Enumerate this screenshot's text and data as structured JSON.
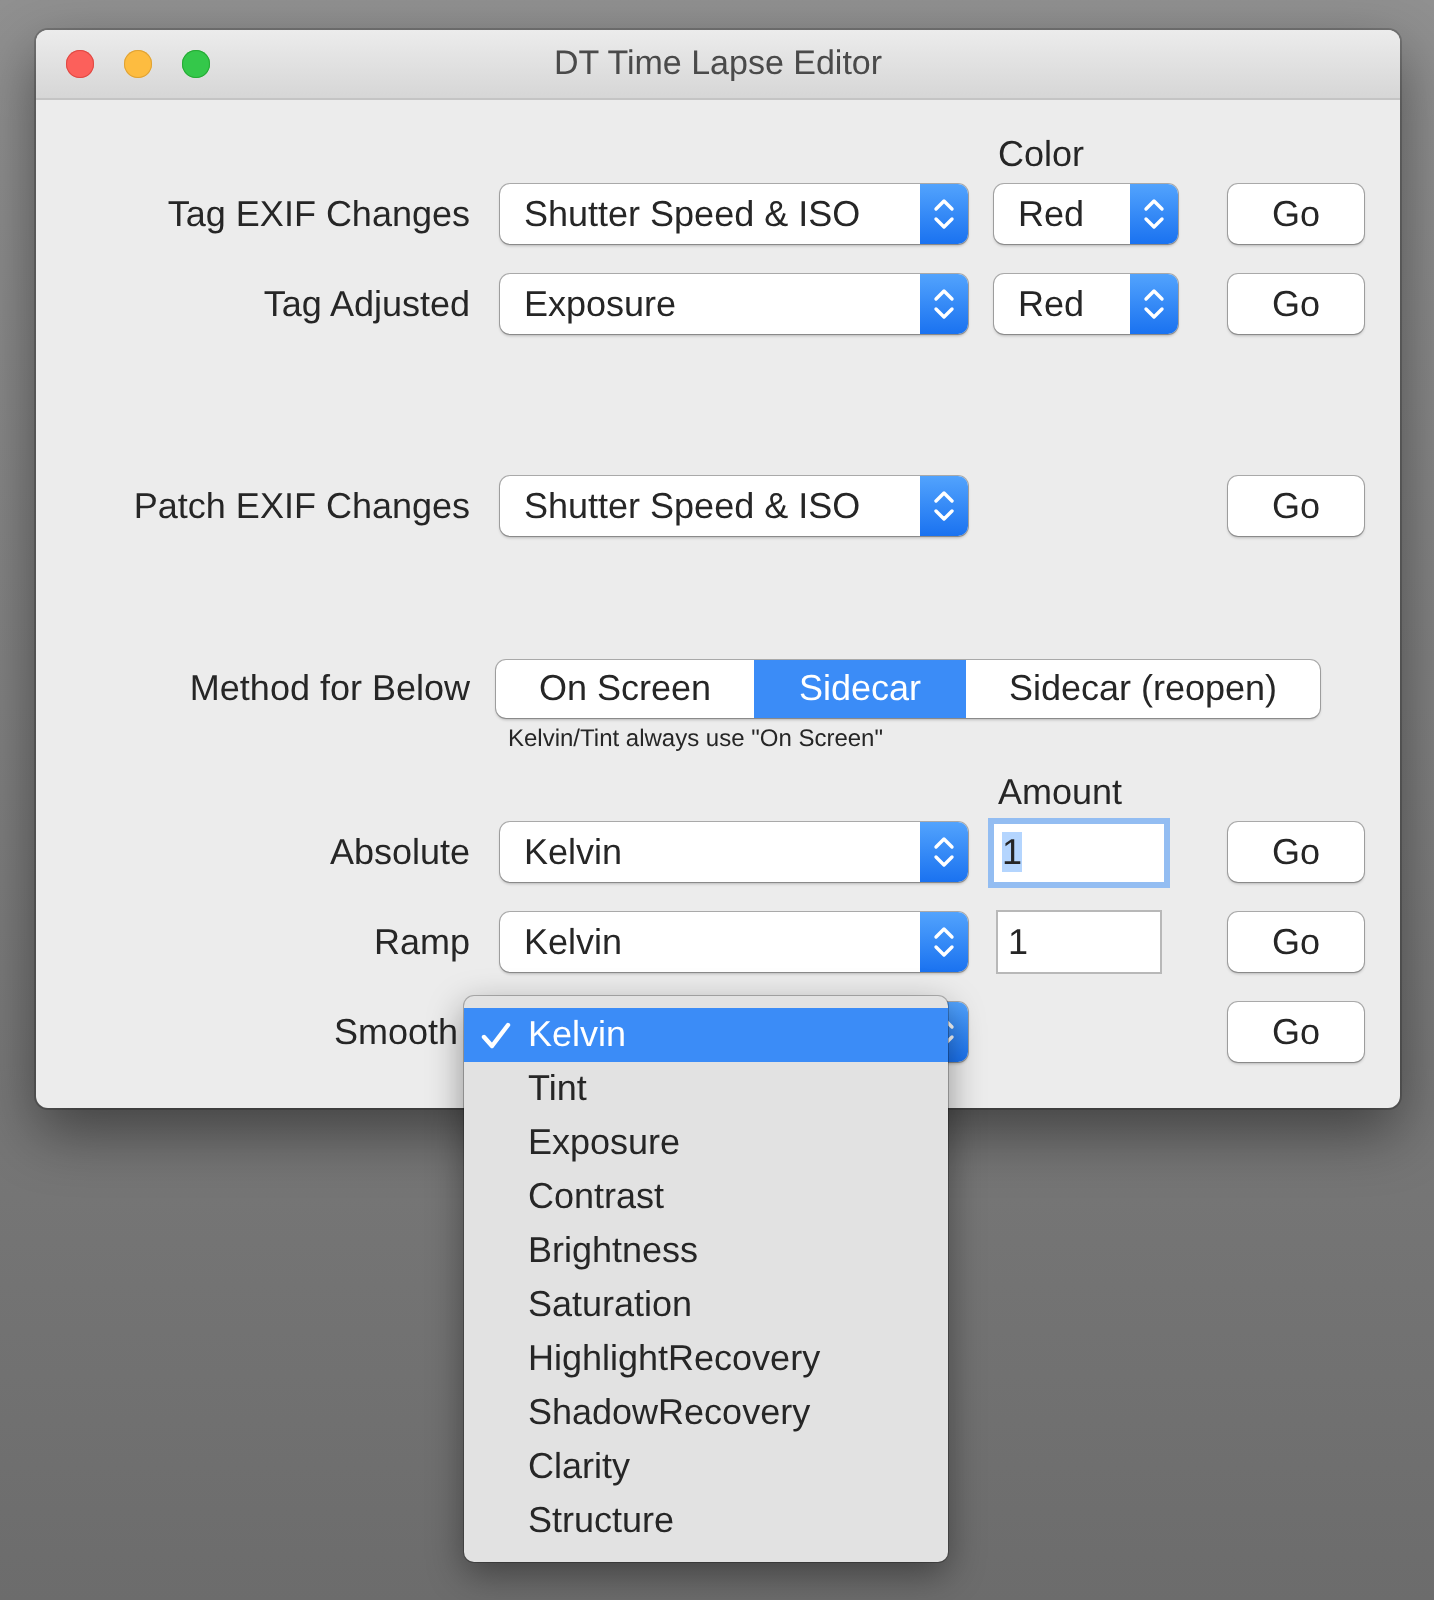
{
  "window": {
    "title": "DT Time Lapse Editor"
  },
  "groups": [
    {
      "header": "Color",
      "rows": [
        {
          "kind": "popup",
          "label": "Tag EXIF Changes",
          "popup": "Shutter Speed & ISO",
          "color_popup": "Red",
          "button": "Go"
        },
        {
          "kind": "popup",
          "label": "Tag Adjusted",
          "popup": "Exposure",
          "color_popup": "Red",
          "button": "Go"
        }
      ]
    },
    {
      "rows": [
        {
          "kind": "popup",
          "label": "Patch EXIF Changes",
          "popup": "Shutter Speed & ISO",
          "button": "Go"
        }
      ]
    },
    {
      "rows": [
        {
          "kind": "segmented",
          "label": "Method for Below",
          "segments": [
            {
              "label": "On Screen",
              "selected": false
            },
            {
              "label": "Sidecar",
              "selected": true
            },
            {
              "label": "Sidecar (reopen)",
              "selected": false
            }
          ],
          "note": "Kelvin/Tint always use \"On Screen\""
        }
      ]
    },
    {
      "header": "Amount",
      "rows": [
        {
          "kind": "popup",
          "label": "Absolute",
          "popup": "Kelvin",
          "amount": {
            "value": "1",
            "focused": true
          },
          "button": "Go"
        },
        {
          "kind": "popup",
          "label": "Ramp",
          "popup": "Kelvin",
          "amount": {
            "value": "1",
            "focused": false
          },
          "button": "Go"
        },
        {
          "kind": "popup",
          "label": "Smooth",
          "button": "Go",
          "menu": [
            {
              "label": "Kelvin",
              "selected": true
            },
            {
              "label": "Tint",
              "selected": false
            },
            {
              "label": "Exposure",
              "selected": false
            },
            {
              "label": "Contrast",
              "selected": false
            },
            {
              "label": "Brightness",
              "selected": false
            },
            {
              "label": "Saturation",
              "selected": false
            },
            {
              "label": "HighlightRecovery",
              "selected": false
            },
            {
              "label": "ShadowRecovery",
              "selected": false
            },
            {
              "label": "Clarity",
              "selected": false
            },
            {
              "label": "Structure",
              "selected": false
            }
          ]
        }
      ]
    }
  ]
}
